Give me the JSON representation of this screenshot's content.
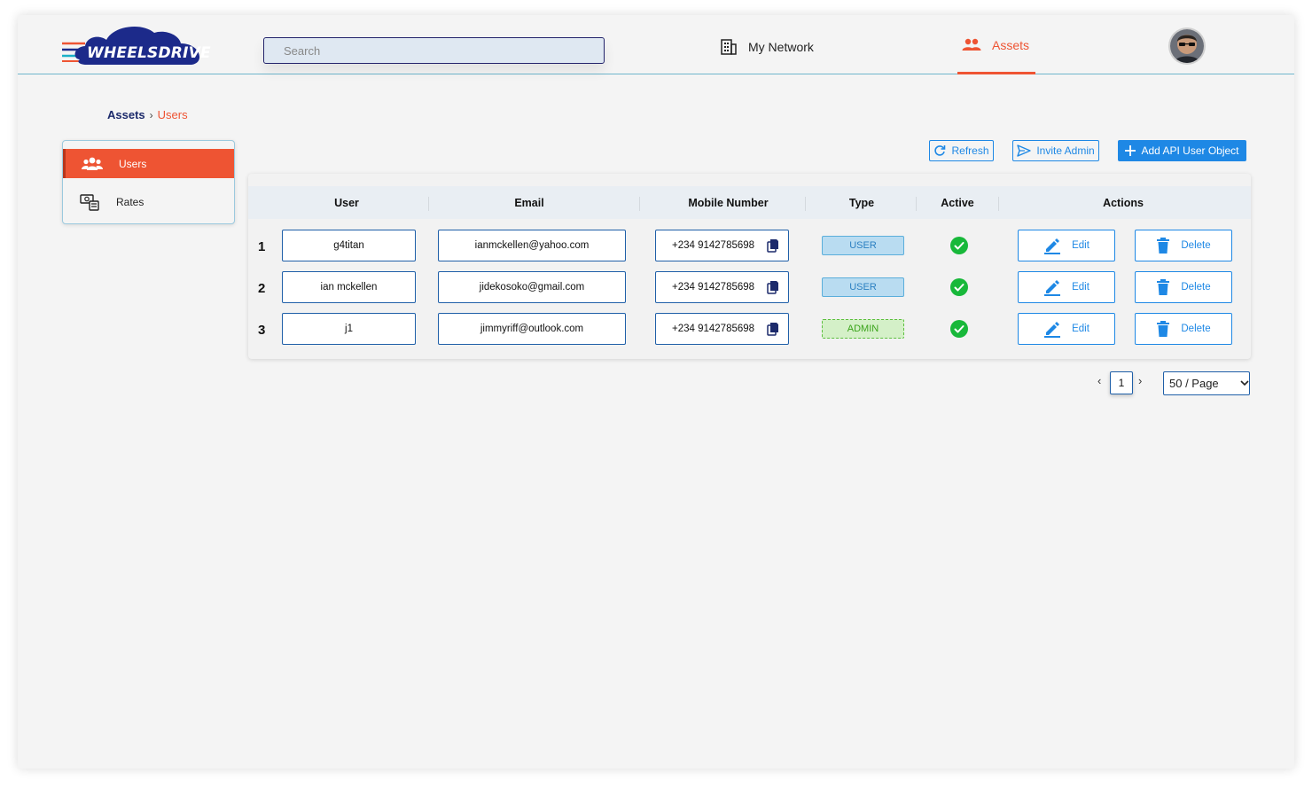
{
  "header": {
    "logo_text": "WHEELSDRIVE",
    "search_placeholder": "Search",
    "nav": {
      "network_label": "My Network",
      "assets_label": "Assets"
    }
  },
  "breadcrumb": {
    "root": "Assets",
    "current": "Users"
  },
  "sidebar": {
    "items": [
      {
        "label": "Users",
        "icon": "users-icon",
        "active": true
      },
      {
        "label": "Rates",
        "icon": "rates-icon",
        "active": false
      }
    ]
  },
  "toolbar": {
    "refresh_label": "Refresh",
    "invite_label": "Invite Admin",
    "add_label": "Add API User Object"
  },
  "table": {
    "columns": [
      "User",
      "Email",
      "Mobile Number",
      "Type",
      "Active",
      "Actions"
    ],
    "rows": [
      {
        "num": "1",
        "user": "g4titan",
        "email": "ianmckellen@yahoo.com",
        "mobile": "+234 9142785698",
        "type": "USER",
        "active": true
      },
      {
        "num": "2",
        "user": "ian mckellen",
        "email": "jidekosoko@gmail.com",
        "mobile": "+234 9142785698",
        "type": "USER",
        "active": true
      },
      {
        "num": "3",
        "user": "j1",
        "email": "jimmyriff@outlook.com",
        "mobile": "+234 9142785698",
        "type": "ADMIN",
        "active": true
      }
    ],
    "edit_label": "Edit",
    "delete_label": "Delete"
  },
  "pagination": {
    "current_page": "1",
    "page_size": "50 / Page"
  },
  "colors": {
    "accent": "#ee5433",
    "primary": "#1e88e5",
    "success": "#18b83a",
    "brand_navy": "#1c2a8a"
  }
}
